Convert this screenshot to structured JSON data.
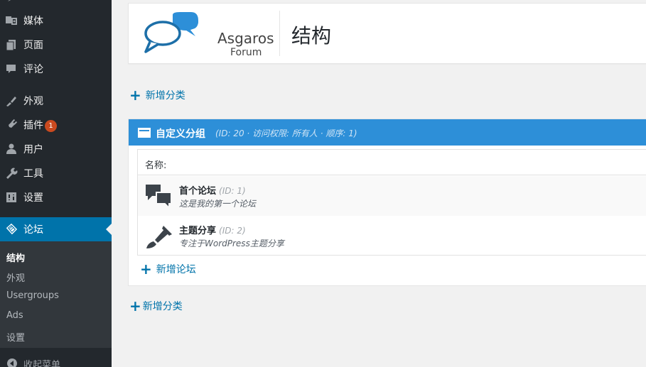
{
  "sidebar": {
    "items": [
      {
        "label": "媒体",
        "icon": "media-icon"
      },
      {
        "label": "页面",
        "icon": "page-icon"
      },
      {
        "label": "评论",
        "icon": "comment-icon"
      },
      {
        "label": "外观",
        "icon": "appearance-icon"
      },
      {
        "label": "插件",
        "icon": "plugin-icon",
        "badge": "1"
      },
      {
        "label": "用户",
        "icon": "user-icon"
      },
      {
        "label": "工具",
        "icon": "wrench-icon"
      },
      {
        "label": "设置",
        "icon": "settings-icon"
      },
      {
        "label": "论坛",
        "icon": "forum-icon"
      }
    ],
    "submenu": [
      "结构",
      "外观",
      "Usergroups",
      "Ads",
      "设置"
    ],
    "collapse_label": "收起菜单"
  },
  "header": {
    "logo_line1": "Asgaros",
    "logo_line2": "Forum",
    "title": "结构"
  },
  "add_category_label": "新增分类",
  "category": {
    "title": "自定义分组",
    "meta": "(ID: 20 · 访问权限:  所有人 · 顺序:  1)",
    "name_header": "名称:",
    "forums": [
      {
        "name": "首个论坛",
        "id": "(ID: 1)",
        "description": "这是我的第一个论坛"
      },
      {
        "name": "主题分享",
        "id": "(ID: 2)",
        "description": "专注于WordPress主题分享"
      }
    ],
    "add_forum_label": "新增论坛"
  },
  "colors": {
    "sidebar_bg": "#23282d",
    "active_blue": "#0073aa",
    "category_header": "#2d8fd8",
    "link": "#0073aa",
    "badge": "#ca4a1f"
  }
}
